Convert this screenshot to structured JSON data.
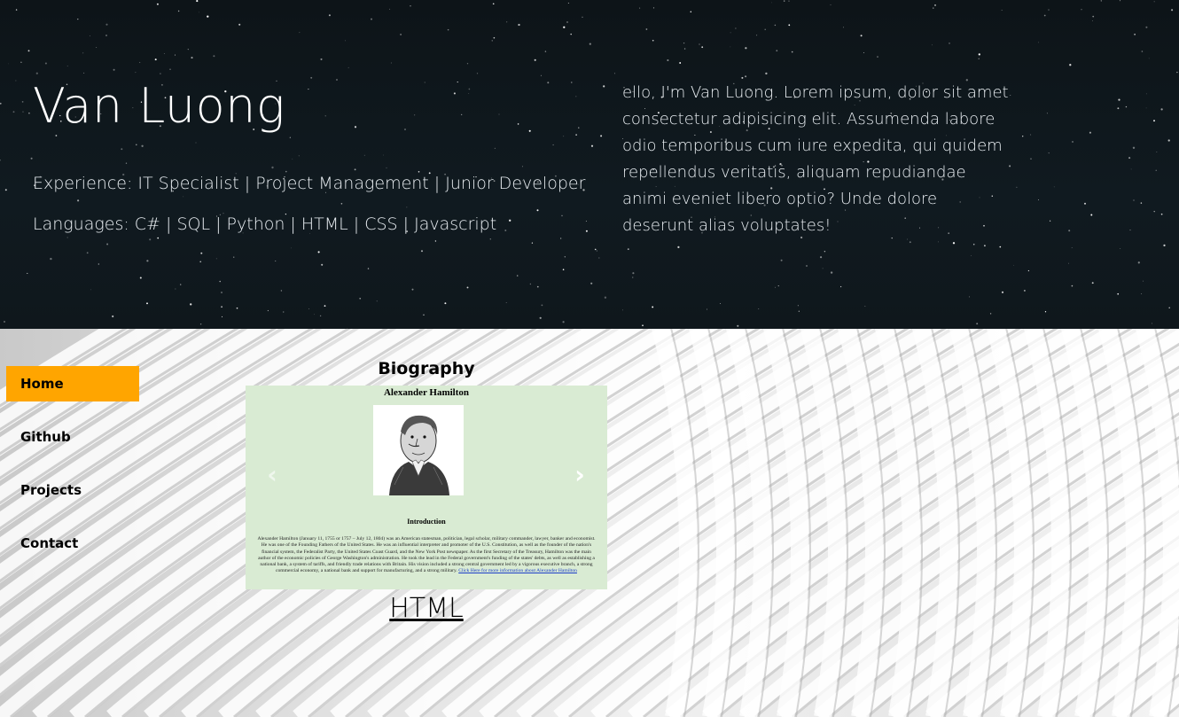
{
  "header": {
    "name": "Van Luong",
    "experience": "Experience: IT Specialist | Project Management | Junior Developer",
    "languages": "Languages: C# | SQL | Python | HTML | CSS | Javascript",
    "intro": "ello, I'm Van Luong. Lorem ipsum, dolor sit amet consectetur adipisicing elit. Assumenda labore odio temporibus cum iure expedita, qui quidem repellendus veritatis, aliquam repudiandae animi eveniet libero optio? Unde dolore deserunt alias voluptates!"
  },
  "nav": {
    "items": [
      {
        "label": "Home",
        "active": true
      },
      {
        "label": "Github",
        "active": false
      },
      {
        "label": "Projects",
        "active": false
      },
      {
        "label": "Contact",
        "active": false
      }
    ]
  },
  "biography": {
    "title": "Biography",
    "slide": {
      "heading": "Alexander Hamilton",
      "subheading": "Introduction",
      "body": "Alexander Hamilton (January 11, 1755 or 1757 – July 12, 1804) was an American statesman, politician, legal scholar, military commander, lawyer, banker and economist. He was one of the Founding Fathers of the United States. He was an influential interpreter and promoter of the U.S. Constitution, as well as the founder of the nation's financial system, the Federalist Party, the United States Coast Guard, and the New York Post newspaper. As the first Secretary of the Treasury, Hamilton was the main author of the economic policies of George Washington's administration. He took the lead in the Federal government's funding of the states' debts, as well as establishing a national bank, a system of tariffs, and friendly trade relations with Britain. His vision included a strong central government led by a vigorous executive branch, a strong commercial economy, a national bank and support for manufacturing, and a strong military.",
      "link_text": "Click Here for more information about Alexander Hamilton"
    },
    "prev_icon": "‹",
    "next_icon": "›",
    "footer_link": "HTML"
  },
  "colors": {
    "active_nav": "#ffa500",
    "slide_bg": "#d9ebd3",
    "hero_bg": "#101a20"
  }
}
